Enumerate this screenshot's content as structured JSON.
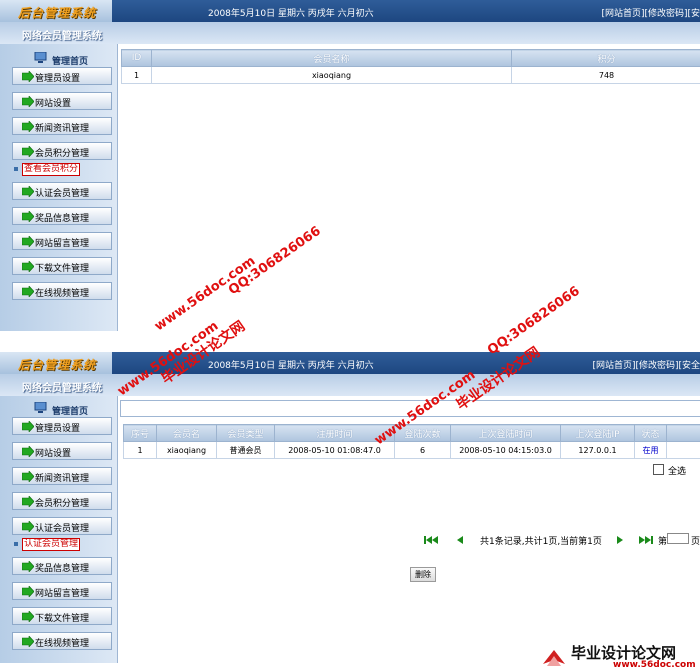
{
  "header": {
    "logo_text": "后台管理系统",
    "date_text": "2008年5月10日 星期六 丙戌年 六月初六",
    "links_top": "[网站首页][修改密码][安",
    "links_bottom": "[网站首页][修改密码][安全",
    "system_title": "网络会员管理系统"
  },
  "sidebar": {
    "head": "管理首页",
    "menu_top": [
      "管理员设置",
      "网站设置",
      "新闻资讯管理",
      "会员积分管理"
    ],
    "sub_top": "查看会员积分",
    "menu_top_rest": [
      "认证会员管理",
      "奖品信息管理",
      "网站留言管理",
      "下载文件管理",
      "在线视频管理"
    ],
    "menu_bottom": [
      "管理员设置",
      "网站设置",
      "新闻资讯管理",
      "会员积分管理",
      "认证会员管理"
    ],
    "sub_bottom": "认证会员管理",
    "menu_bottom_rest": [
      "奖品信息管理",
      "网站留言管理",
      "下载文件管理",
      "在线视频管理"
    ]
  },
  "points_table": {
    "headers": [
      "ID",
      "会员名称",
      "积分"
    ],
    "rows": [
      [
        "1",
        "xiaoqiang",
        "748"
      ]
    ]
  },
  "members_table": {
    "headers": [
      "序号",
      "会员名",
      "会员类型",
      "注册时间",
      "登陆次数",
      "上次登陆时间",
      "上次登陆IP",
      "状态",
      ""
    ],
    "rows": [
      [
        "1",
        "xiaoqiang",
        "普通会员",
        "2008-05-10 01:08:47.0",
        "6",
        "2008-05-10 04:15:03.0",
        "127.0.0.1",
        "在用",
        ""
      ]
    ]
  },
  "select_all": "全选",
  "pager": {
    "summary": "共1条记录,共计1页,当前第1页",
    "goto_prefix": "第",
    "goto_suffix": "页",
    "page_input": ""
  },
  "delete_button": "删除",
  "watermarks": {
    "site": "www.56doc.com",
    "qq": "QQ:306826066",
    "name": "毕业设计论文网",
    "footer_url": "www.56doc.com"
  },
  "colors": {
    "header_blue": "#1d4680",
    "sidebar_blue": "#b6cde6",
    "watermark_red": "#e01010",
    "status_blue": "#0000cc"
  }
}
